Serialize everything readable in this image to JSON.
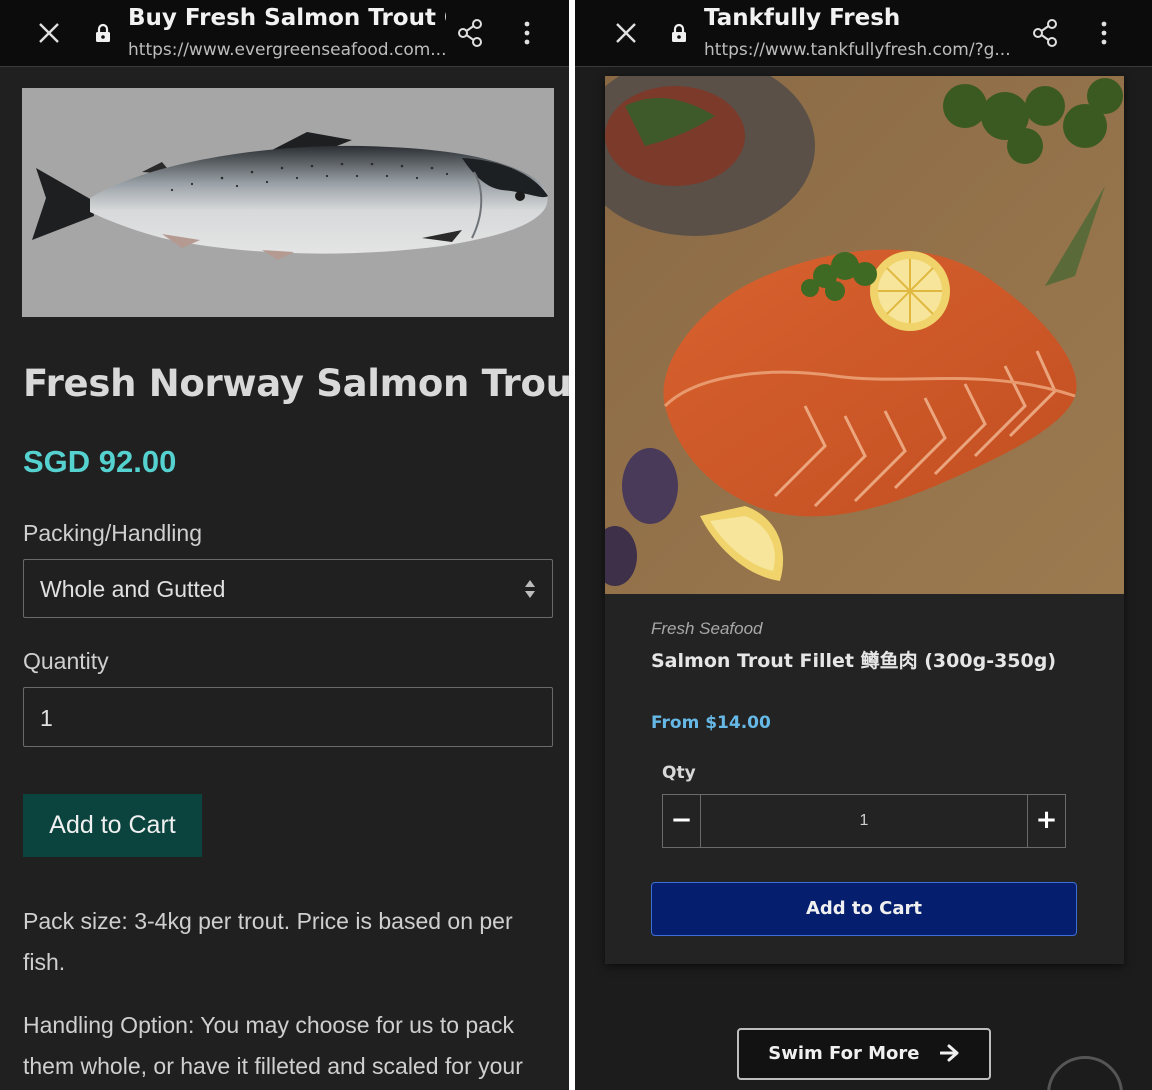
{
  "left": {
    "browser": {
      "title": "Buy Fresh Salmon Trout O...",
      "url": "https://www.evergreenseafood.com..."
    },
    "product": {
      "title": "Fresh Norway Salmon Trout",
      "price": "SGD 92.00",
      "packing_label": "Packing/Handling",
      "packing_value": "Whole and Gutted",
      "quantity_label": "Quantity",
      "quantity_value": "1",
      "add_to_cart": "Add to Cart",
      "desc_1_line_1": "Pack size: 3-4kg per trout. Price is based on per",
      "desc_1_line_2": "fish.",
      "desc_2_line_1": "Handling Option: You may choose for us to pack",
      "desc_2_line_2": "them whole, or have it filleted and scaled for your"
    }
  },
  "right": {
    "browser": {
      "title": "Tankfully Fresh",
      "url": "https://www.tankfullyfresh.com/?g..."
    },
    "product": {
      "category": "Fresh Seafood",
      "title": "Salmon Trout Fillet 鳟鱼肉 (300g-350g)",
      "price": "From $14.00",
      "qty_label": "Qty",
      "qty_minus": "−",
      "qty_value": "1",
      "qty_plus": "+",
      "add_to_cart": "Add to Cart",
      "swim_more": "Swim For More"
    }
  },
  "icons": [
    "close-icon",
    "lock-icon",
    "share-icon",
    "more-vert-icon",
    "select-arrows-icon",
    "arrow-right-icon"
  ],
  "colors": {
    "price_teal": "#55d1cf",
    "left_cart_button": "#0b443f",
    "right_price_blue": "#66b8e6",
    "right_cart_button": "#051f6e"
  }
}
